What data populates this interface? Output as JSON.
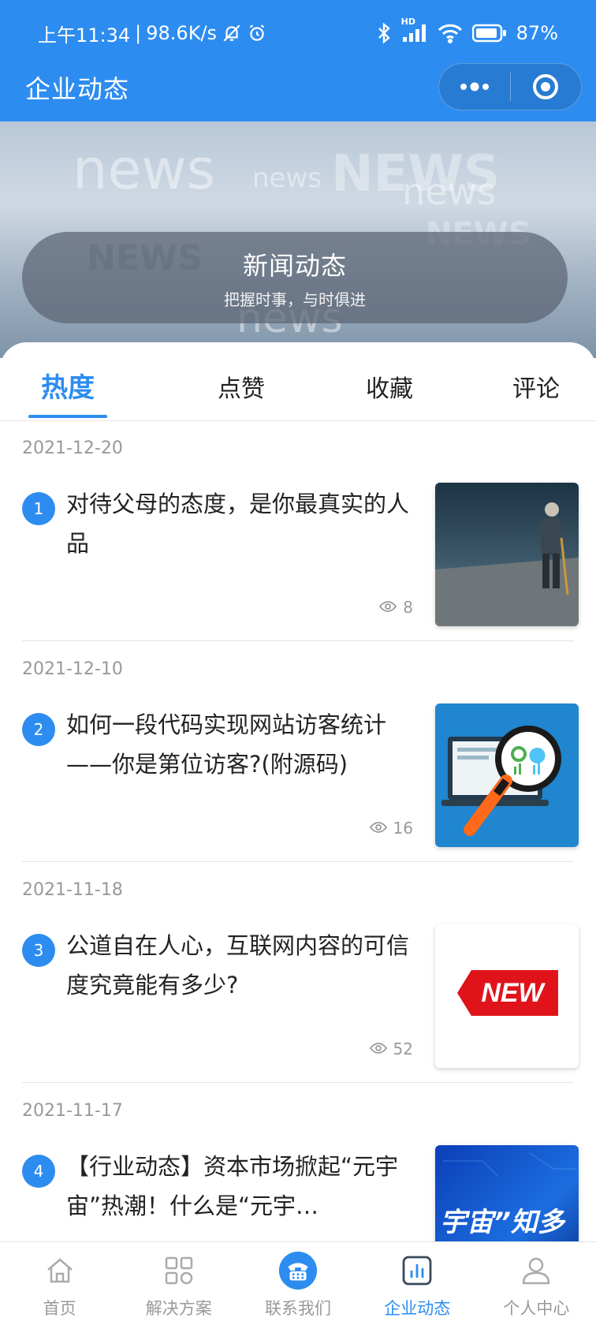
{
  "status_bar": {
    "time": "上午11:34",
    "net_speed": "98.6K/s",
    "network": "HD",
    "battery": "87%"
  },
  "titlebar": {
    "title": "企业动态"
  },
  "banner": {
    "title": "新闻动态",
    "subtitle": "把握时事，与时俱进",
    "watermark_words": [
      "news",
      "NEWS"
    ]
  },
  "tabs": [
    {
      "label": "热度",
      "active": true
    },
    {
      "label": "点赞",
      "active": false
    },
    {
      "label": "收藏",
      "active": false
    },
    {
      "label": "评论",
      "active": false
    }
  ],
  "news": [
    {
      "date": "2021-12-20",
      "rank": "1",
      "title": "对待父母的态度，是你最真实的人品",
      "views": "8",
      "thumb": "elderly-man-walking"
    },
    {
      "date": "2021-12-10",
      "rank": "2",
      "title": "如何一段代码实现网站访客统计——你是第位访客?(附源码)",
      "views": "16",
      "thumb": "laptop-magnifier"
    },
    {
      "date": "2021-11-18",
      "rank": "3",
      "title": "公道自在人心，互联网内容的可信度究竟能有多少?",
      "views": "52",
      "thumb": "new-tag",
      "thumb_text": "NEW"
    },
    {
      "date": "2021-11-17",
      "rank": "4",
      "title": "【行业动态】资本市场掀起“元宇宙”热潮！什么是“元宇…",
      "views": "",
      "thumb": "metaverse-banner",
      "thumb_text": "宇宙”知多"
    }
  ],
  "bottom_nav": [
    {
      "label": "首页",
      "icon": "home-icon",
      "active": false
    },
    {
      "label": "解决方案",
      "icon": "grid-icon",
      "active": false
    },
    {
      "label": "联系我们",
      "icon": "phone-icon",
      "active": false
    },
    {
      "label": "企业动态",
      "icon": "chart-icon",
      "active": true
    },
    {
      "label": "个人中心",
      "icon": "user-icon",
      "active": false
    }
  ],
  "colors": {
    "primary": "#2d8cf0",
    "text": "#222222",
    "muted": "#999999"
  }
}
